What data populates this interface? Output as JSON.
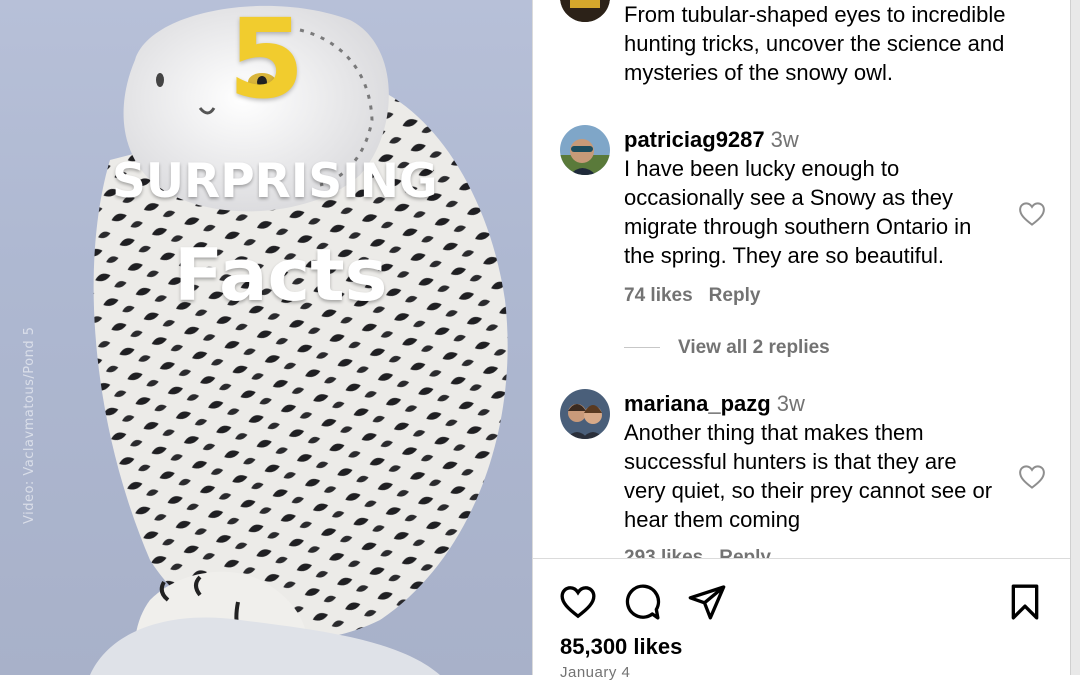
{
  "media": {
    "big_number": "5",
    "line1": "SURPRISING",
    "line2": "Facts",
    "credit": "Video: Vaclavmatous/Pond 5"
  },
  "caption": {
    "text": "From tubular-shaped eyes to incredible hunting tricks, uncover the science and mysteries of the snowy owl."
  },
  "comments": [
    {
      "user": "patriciag9287",
      "time": "3w",
      "text": "I have been lucky enough to occasionally see a Snowy as they migrate through southern Ontario in the spring. They are so beautiful.",
      "likes": "74 likes",
      "reply": "Reply",
      "view_replies": "View all 2 replies"
    },
    {
      "user": "mariana_pazg",
      "time": "3w",
      "text": "Another thing that makes them successful hunters is that they are very quiet, so their prey cannot see or hear them coming",
      "likes": "293 likes",
      "reply": "Reply"
    }
  ],
  "post": {
    "likes": "85,300 likes",
    "date": "January 4"
  },
  "icons": {
    "like": "heart-icon",
    "comment": "comment-bubble-icon",
    "share": "paper-plane-icon",
    "save": "bookmark-icon"
  },
  "colors": {
    "accent_yellow": "#f1cc2e",
    "meta_gray": "#737373",
    "divider": "#dbdbdb"
  }
}
